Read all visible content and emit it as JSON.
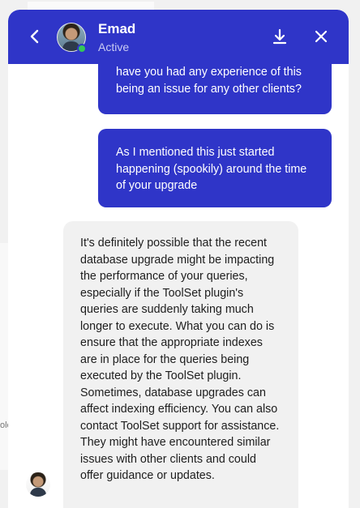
{
  "background": {
    "partial_text": "ole"
  },
  "header": {
    "contact_name": "Emad",
    "contact_status": "Active",
    "accent_color": "#2f35c8",
    "status_dot_color": "#34c759",
    "icons": {
      "back": "chevron-left-icon",
      "download": "download-icon",
      "close": "close-icon"
    }
  },
  "messages": [
    {
      "direction": "outgoing",
      "text": "have you had any experience of this being an issue for any other clients?"
    },
    {
      "direction": "outgoing",
      "text": "As I mentioned this just started happening (spookily) around the time of your upgrade"
    },
    {
      "direction": "incoming",
      "text": "It's definitely possible that the recent database upgrade might be impacting the performance of your queries, especially if the ToolSet plugin's queries are suddenly taking much longer to execute. What you can do is ensure that the appropriate indexes are in place for the queries being executed by the ToolSet plugin. Sometimes, database upgrades can affect indexing efficiency. You can also contact ToolSet support for assistance. They might have encountered similar issues with other clients and could offer guidance or updates."
    }
  ]
}
